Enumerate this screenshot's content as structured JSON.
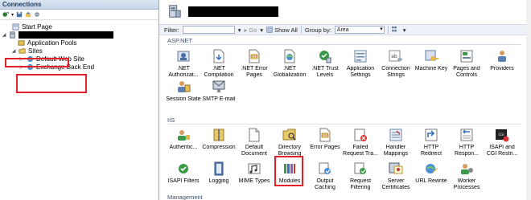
{
  "left_pane": {
    "title": "Connections",
    "tree": {
      "start_page": "Start Page",
      "app_pools": "Application Pools",
      "sites": "Sites",
      "site1": "Default Web Site",
      "site2": "Exchange Back End"
    }
  },
  "filter_bar": {
    "filter_label": "Filter:",
    "go_label": "Go",
    "show_all_label": "Show All",
    "group_by_label": "Group by:",
    "group_by_value": "Area"
  },
  "sections": {
    "aspnet": "ASP.NET",
    "iis": "IIS",
    "management": "Management"
  },
  "aspnet_features": [
    ".NET",
    "Authorizat...",
    ".NET",
    "Compilation",
    ".NET Error",
    "Pages",
    ".NET",
    "Globalization",
    ".NET Trust",
    "Levels",
    "Application",
    "Settings",
    "Connection",
    "Strings",
    "Machine Key",
    "",
    "Pages and",
    "Controls",
    "Providers",
    "",
    "Session State",
    "",
    "SMTP E-mail",
    ""
  ],
  "iis_features": [
    "Authentic...",
    "",
    "Compression",
    "",
    "Default",
    "Document",
    "Directory",
    "Browsing",
    "Error Pages",
    "",
    "Failed",
    "Request Tra...",
    "Handler",
    "Mappings",
    "HTTP",
    "Redirect",
    "HTTP",
    "Respon...",
    "ISAPI and",
    "CGI Restri...",
    "ISAPI Filters",
    "",
    "Logging",
    "",
    "MIME Types",
    "",
    "Modules",
    "",
    "Output",
    "Caching",
    "Request",
    "Filtering",
    "Server",
    "Certificates",
    "URL Rewrite",
    "",
    "Worker",
    "Processes"
  ]
}
